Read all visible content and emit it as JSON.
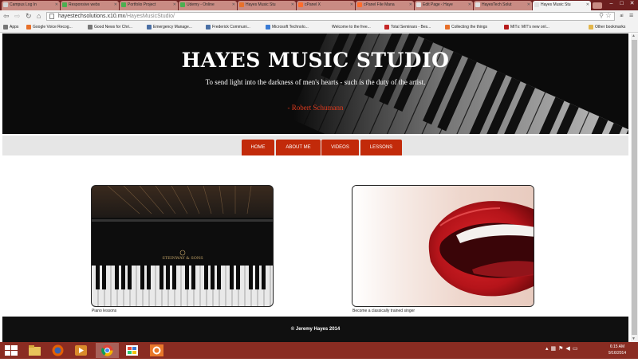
{
  "browser": {
    "tabs": [
      {
        "label": "Campus Log In",
        "color": "#d4d4d4"
      },
      {
        "label": "Responsive webs",
        "color": "#4caf50"
      },
      {
        "label": "Portfolio Project",
        "color": "#4caf50"
      },
      {
        "label": "Udemy - Online",
        "color": "#4caf50"
      },
      {
        "label": "Hayes Music Stu",
        "color": "#e8702a"
      },
      {
        "label": "cPanel X",
        "color": "#ff6c2c"
      },
      {
        "label": "cPanel File Mana",
        "color": "#ff6c2c"
      },
      {
        "label": "Edit Page ‹ Haye",
        "color": "#e0e0e0"
      },
      {
        "label": "HayesTech Solut",
        "color": "#e0e0e0"
      },
      {
        "label": "Hayes Music Stu",
        "color": "#e0e0e0"
      }
    ],
    "active_tab_index": 9,
    "address": {
      "domain": "hayestechsolutions.x10.mx",
      "path": "/HayesMusicStudio/"
    },
    "extension_label": "ai",
    "bookmarks": [
      {
        "label": "Apps",
        "color": "#777777"
      },
      {
        "label": "Google Voice Recog...",
        "color": "#e8702a"
      },
      {
        "label": "Good News for Chri...",
        "color": "#777777"
      },
      {
        "label": "Emergency Manage...",
        "color": "#4a6fa5"
      },
      {
        "label": "Frederick Communi...",
        "color": "#4a6fa5"
      },
      {
        "label": "Microsoft Technolo...",
        "color": "#3a7bd5"
      },
      {
        "label": "Welcome to the free...",
        "color": "#f2f2f2"
      },
      {
        "label": "Total Seminars - Bes...",
        "color": "#c62828"
      },
      {
        "label": "Collecting the things",
        "color": "#e8702a"
      },
      {
        "label": "MITx: MIT's new onl...",
        "color": "#b71c1c"
      }
    ],
    "other_bookmarks": "Other bookmarks"
  },
  "site": {
    "title": "HAYES MUSIC STUDIO",
    "tagline": "To send light into the darkness of men's hearts - such is the duty of the artist.",
    "quote_author": "- Robert Schumann",
    "accent_color": "#c22a0a",
    "nav": [
      {
        "label": "HOME"
      },
      {
        "label": "ABOUT ME"
      },
      {
        "label": "VIDEOS"
      },
      {
        "label": "LESSONS"
      }
    ],
    "features": [
      {
        "caption": "Piano lessons",
        "image": "grand-piano-photo"
      },
      {
        "caption": "Become a classically trained singer",
        "image": "singer-lips-photo"
      }
    ],
    "footer": "© Jeremy Hayes 2014"
  },
  "taskbar": {
    "time": "6:15 AM",
    "date": "9/16/2014",
    "pinned": [
      "windows-start-icon",
      "file-explorer-icon",
      "firefox-icon",
      "media-player-icon",
      "chrome-icon",
      "store-icon",
      "settings-icon"
    ]
  }
}
